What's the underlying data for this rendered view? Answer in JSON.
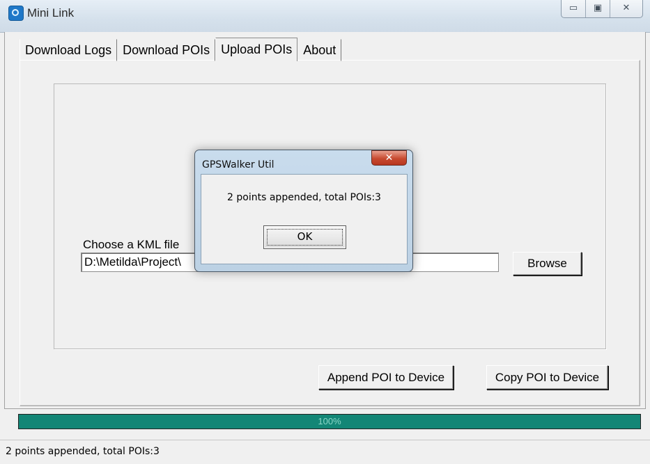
{
  "window": {
    "title": "Mini Link",
    "minimize_glyph": "▭",
    "maximize_glyph": "▣",
    "close_glyph": "✕"
  },
  "tabs": [
    {
      "label": "Download Logs",
      "active": false
    },
    {
      "label": "Download POIs",
      "active": false
    },
    {
      "label": "Upload POIs",
      "active": true
    },
    {
      "label": "About",
      "active": false
    }
  ],
  "upload": {
    "kml_label": "Choose a KML file",
    "kml_path": "D:\\Metilda\\Project\\",
    "browse_label": "Browse",
    "append_label": "Append POI to Device",
    "copy_label": "Copy POI to Device"
  },
  "progress": {
    "value": 1.0,
    "text": "100%",
    "fill_color": "#138676"
  },
  "status": {
    "text": "2 points appended, total POIs:3"
  },
  "dialog": {
    "title": "GPSWalker Util",
    "message": "2 points appended, total POIs:3",
    "ok_label": "OK",
    "close_glyph": "✕"
  },
  "colors": {
    "window_bg": "#f0f0f0",
    "dialog_frame": "#bcd1e4",
    "dialog_close": "#c74a30"
  },
  "icons": {
    "app": "app-icon"
  }
}
